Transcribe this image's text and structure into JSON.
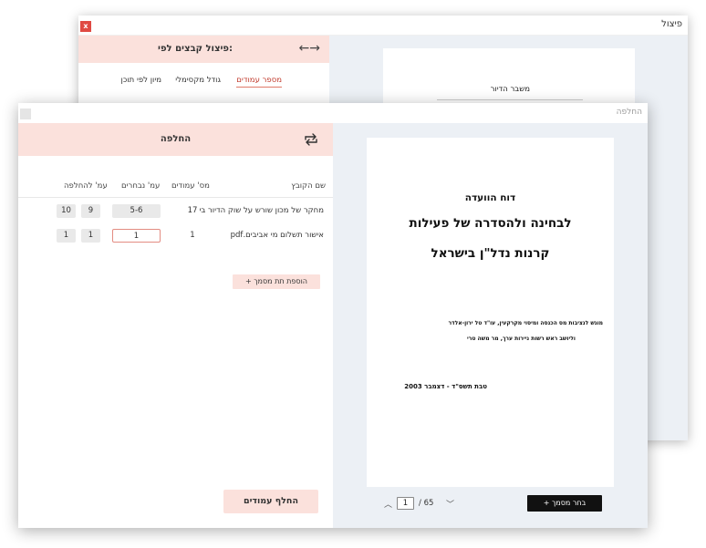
{
  "split_window": {
    "title": "פיצול",
    "panel_title": "פיצול קבצים לפי:",
    "tabs": [
      {
        "label": "מספר עמודים",
        "active": true
      },
      {
        "label": "גודל מקסימלי",
        "active": false
      },
      {
        "label": "מיון לפי תוכן",
        "active": false
      }
    ],
    "field_label": "משבר הדיור"
  },
  "replace_window": {
    "title": "החלפה",
    "panel_title": "החלפה",
    "table": {
      "headers": {
        "file_name": "שם הקובץ",
        "page_count": "מס' עמודים",
        "selected_pages": "עמ' נבחרים",
        "replace_pages": "עמ' להחלפה"
      },
      "rows": [
        {
          "name": "מחקר של מכון שורש על שוק הדיור בי",
          "pages": "17",
          "selected": "5-6",
          "replace_from": "9",
          "replace_to": "10"
        },
        {
          "name": "אישור תשלום מי אביבים.pdf",
          "pages": "1",
          "selected": "1",
          "replace_from": "1",
          "replace_to": "1"
        }
      ]
    },
    "add_doc_button": "+ הוספת תת מסמך",
    "replace_button": "החלף עמודים",
    "preview": {
      "line1": "דוח הוועדה",
      "line2": "לבחינה ולהסדרה של פעילות",
      "line3": "קרנות נדל\"ן בישראל",
      "line4": "מוגש לנציבות מס הכנסה ומיסוי מקרקעין, עו\"ד טל ירון-אלדר",
      "line5": "וליושב ראש רשות ניירות ערך, מר משה טרי",
      "line6": "טבת תשס\"ד - דצמבר 2003"
    },
    "pager": {
      "current": "1",
      "total": "/ 65"
    },
    "choose_doc_button": "+ בחר מסמך"
  },
  "colors": {
    "accent_pink": "#fbe1dc",
    "close_red": "#e04a43",
    "preview_bg": "#ecf0f5"
  }
}
